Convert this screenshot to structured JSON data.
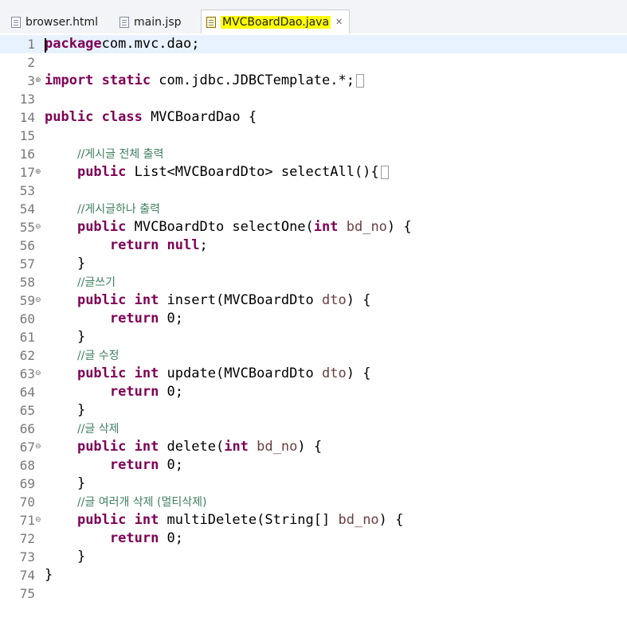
{
  "tabs": [
    {
      "label": "browser.html",
      "active": false
    },
    {
      "label": "main.jsp",
      "active": false
    },
    {
      "label": "MVCBoardDao.java",
      "active": true,
      "close": "✕"
    }
  ],
  "lines": [
    {
      "n": "1",
      "fold": "",
      "code": [
        [
          "kw",
          "package"
        ],
        [
          "",
          "com.mvc.dao;"
        ]
      ]
    },
    {
      "n": "2",
      "fold": "",
      "code": []
    },
    {
      "n": "3",
      "fold": "⊕",
      "code": [
        [
          "kw",
          "import static"
        ],
        [
          "",
          " com.jdbc.JDBCTemplate.*;"
        ],
        [
          "box",
          ""
        ]
      ]
    },
    {
      "n": "13",
      "fold": "",
      "code": []
    },
    {
      "n": "14",
      "fold": "",
      "code": [
        [
          "kw",
          "public class"
        ],
        [
          "",
          " MVCBoardDao {"
        ]
      ]
    },
    {
      "n": "15",
      "fold": "",
      "code": []
    },
    {
      "n": "16",
      "fold": "",
      "code": [
        [
          "",
          "    "
        ],
        [
          "cm",
          "//게시글 전체 출력"
        ]
      ]
    },
    {
      "n": "17",
      "fold": "⊕",
      "code": [
        [
          "",
          "    "
        ],
        [
          "kw",
          "public"
        ],
        [
          "",
          " List<MVCBoardDto> selectAll(){"
        ],
        [
          "box",
          ""
        ]
      ]
    },
    {
      "n": "53",
      "fold": "",
      "code": []
    },
    {
      "n": "54",
      "fold": "",
      "code": [
        [
          "",
          "    "
        ],
        [
          "cm",
          "//게시글하나 출력"
        ]
      ]
    },
    {
      "n": "55",
      "fold": "⊖",
      "code": [
        [
          "",
          "    "
        ],
        [
          "kw",
          "public"
        ],
        [
          "",
          " MVCBoardDto selectOne("
        ],
        [
          "kw",
          "int"
        ],
        [
          " pm",
          " bd_no"
        ],
        [
          "",
          ") {"
        ]
      ]
    },
    {
      "n": "56",
      "fold": "",
      "code": [
        [
          "",
          "        "
        ],
        [
          "kw",
          "return null"
        ],
        [
          "",
          ";"
        ]
      ]
    },
    {
      "n": "57",
      "fold": "",
      "code": [
        [
          "",
          "    }"
        ]
      ]
    },
    {
      "n": "58",
      "fold": "",
      "code": [
        [
          "",
          "    "
        ],
        [
          "cm",
          "//글쓰기"
        ]
      ]
    },
    {
      "n": "59",
      "fold": "⊖",
      "code": [
        [
          "",
          "    "
        ],
        [
          "kw",
          "public int"
        ],
        [
          "",
          " insert(MVCBoardDto "
        ],
        [
          "pm",
          "dto"
        ],
        [
          "",
          ") {"
        ]
      ]
    },
    {
      "n": "60",
      "fold": "",
      "code": [
        [
          "",
          "        "
        ],
        [
          "kw",
          "return"
        ],
        [
          "",
          " 0;"
        ]
      ]
    },
    {
      "n": "61",
      "fold": "",
      "code": [
        [
          "",
          "    }"
        ]
      ]
    },
    {
      "n": "62",
      "fold": "",
      "code": [
        [
          "",
          "    "
        ],
        [
          "cm",
          "//글 수정"
        ]
      ]
    },
    {
      "n": "63",
      "fold": "⊖",
      "code": [
        [
          "",
          "    "
        ],
        [
          "kw",
          "public int"
        ],
        [
          "",
          " update(MVCBoardDto "
        ],
        [
          "pm",
          "dto"
        ],
        [
          "",
          ") {"
        ]
      ]
    },
    {
      "n": "64",
      "fold": "",
      "code": [
        [
          "",
          "        "
        ],
        [
          "kw",
          "return"
        ],
        [
          "",
          " 0;"
        ]
      ]
    },
    {
      "n": "65",
      "fold": "",
      "code": [
        [
          "",
          "    }"
        ]
      ]
    },
    {
      "n": "66",
      "fold": "",
      "code": [
        [
          "",
          "    "
        ],
        [
          "cm",
          "//글 삭제"
        ]
      ]
    },
    {
      "n": "67",
      "fold": "⊖",
      "code": [
        [
          "",
          "    "
        ],
        [
          "kw",
          "public int"
        ],
        [
          "",
          " delete("
        ],
        [
          "kw",
          "int"
        ],
        [
          " pm",
          " bd_no"
        ],
        [
          "",
          ") {"
        ]
      ]
    },
    {
      "n": "68",
      "fold": "",
      "code": [
        [
          "",
          "        "
        ],
        [
          "kw",
          "return"
        ],
        [
          "",
          " 0;"
        ]
      ]
    },
    {
      "n": "69",
      "fold": "",
      "code": [
        [
          "",
          "    }"
        ]
      ]
    },
    {
      "n": "70",
      "fold": "",
      "code": [
        [
          "",
          "    "
        ],
        [
          "cm",
          "//글 여러개 삭제 (멀티삭제)"
        ]
      ]
    },
    {
      "n": "71",
      "fold": "⊖",
      "code": [
        [
          "",
          "    "
        ],
        [
          "kw",
          "public int"
        ],
        [
          "",
          " multiDelete(String[] "
        ],
        [
          "pm",
          "bd_no"
        ],
        [
          "",
          ") {"
        ]
      ]
    },
    {
      "n": "72",
      "fold": "",
      "code": [
        [
          "",
          "        "
        ],
        [
          "kw",
          "return"
        ],
        [
          "",
          " 0;"
        ]
      ]
    },
    {
      "n": "73",
      "fold": "",
      "code": [
        [
          "",
          "    }"
        ]
      ]
    },
    {
      "n": "74",
      "fold": "",
      "code": [
        [
          "",
          "}"
        ]
      ]
    },
    {
      "n": "75",
      "fold": "",
      "code": []
    }
  ]
}
